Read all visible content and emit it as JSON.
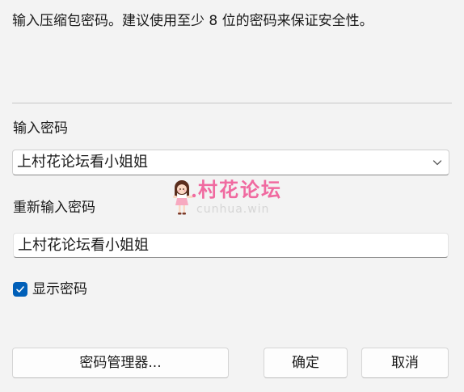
{
  "dialog": {
    "instruction": "输入压缩包密码。建议使用至少 8 位的密码来保证安全性。",
    "password_label": "输入密码",
    "password_value": "上村花论坛看小姐姐",
    "reenter_label": "重新输入密码",
    "reenter_value": "上村花论坛看小姐姐",
    "show_password_label": "显示密码",
    "show_password_checked": true
  },
  "buttons": {
    "manager": "密码管理器...",
    "ok": "确定",
    "cancel": "取消"
  },
  "watermark": {
    "name": "村花论坛",
    "domain": "cunhua.win"
  },
  "colors": {
    "accent": "#005fb8",
    "watermark_pink": "#f06aa0",
    "background": "#f3f3f3"
  },
  "icons": {
    "dropdown": "chevron-down-icon",
    "checkbox": "checkmark-icon"
  }
}
